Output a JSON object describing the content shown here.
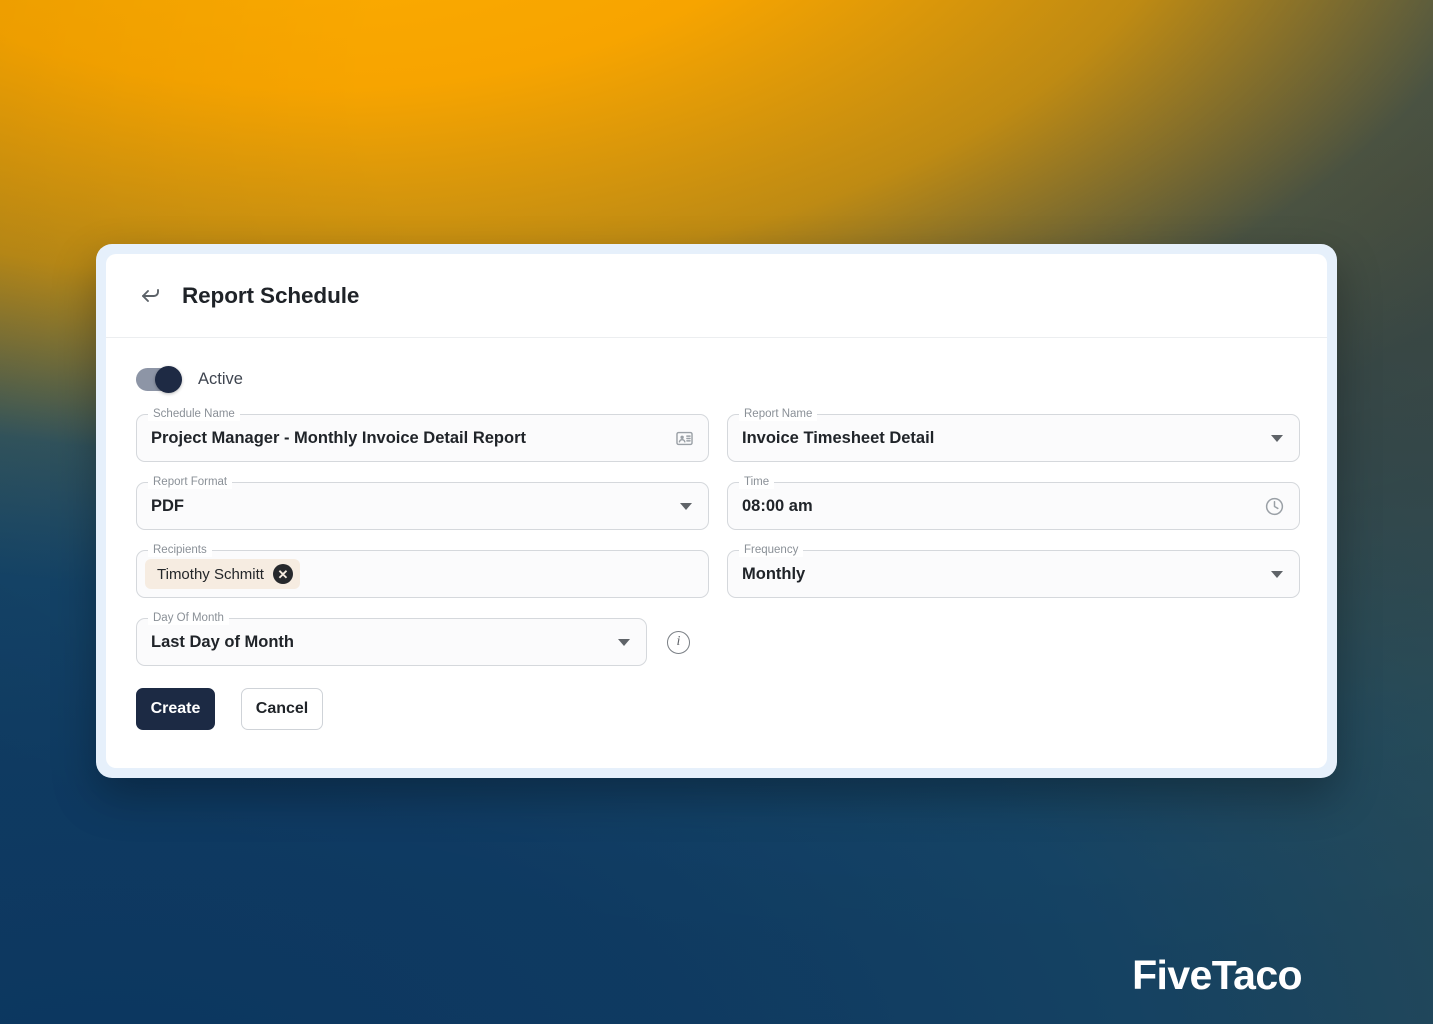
{
  "background": {
    "orange": "#F5A300",
    "navy": "#123A5E",
    "olive": "#4B5A4E"
  },
  "watermark": {
    "text": "FiveTaco"
  },
  "card": {
    "frame_color": "#E6F0FB",
    "header": {
      "back_icon": "back-arrow-icon",
      "title": "Report Schedule"
    },
    "toggle": {
      "label": "Active",
      "state": "on",
      "knob_color": "#1E2A44",
      "track_color": "#8D95A6"
    },
    "fields": {
      "schedule_name": {
        "label": "Schedule Name",
        "value": "Project Manager - Monthly Invoice Detail Report",
        "trailing_icon": "contact-card-icon"
      },
      "report_name": {
        "label": "Report Name",
        "value": "Invoice Timesheet Detail",
        "trailing_icon": "chevron-down-icon"
      },
      "report_format": {
        "label": "Report Format",
        "value": "PDF",
        "trailing_icon": "chevron-down-icon"
      },
      "time": {
        "label": "Time",
        "value": "08:00 am",
        "trailing_icon": "clock-icon"
      },
      "recipients": {
        "label": "Recipients",
        "chips": [
          {
            "name": "Timothy Schmitt",
            "remove_label": "✕"
          }
        ],
        "chip_bg": "#F6ECE1"
      },
      "frequency": {
        "label": "Frequency",
        "value": "Monthly",
        "trailing_icon": "chevron-down-icon"
      },
      "day_of_month": {
        "label": "Day Of Month",
        "value": "Last Day of Month",
        "trailing_icon": "chevron-down-icon",
        "info_icon": "info-icon",
        "info_glyph": "i"
      }
    },
    "buttons": {
      "create": "Create",
      "cancel": "Cancel",
      "create_bg": "#1C2A44"
    }
  }
}
